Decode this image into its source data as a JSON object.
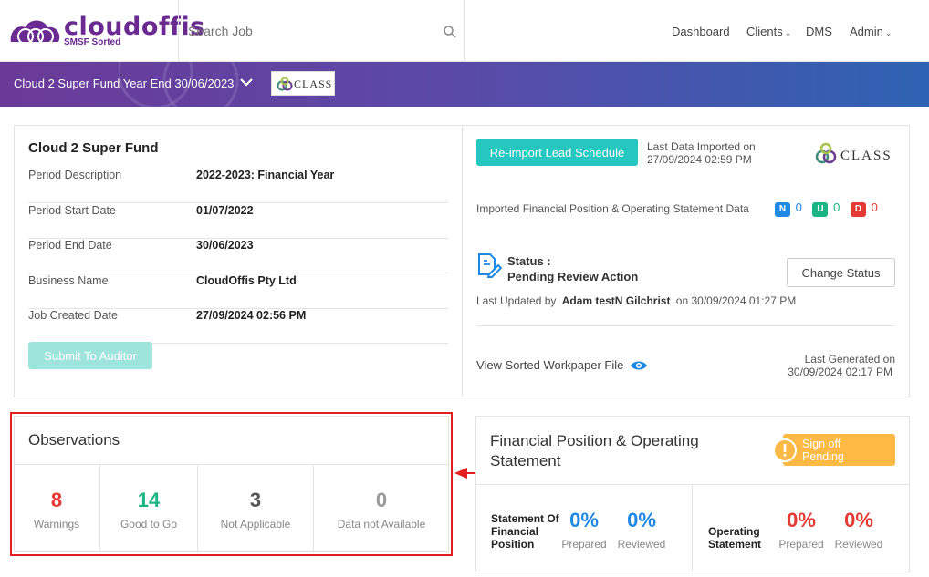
{
  "header": {
    "logo_name": "cloudoffis",
    "logo_sub": "SMSF Sorted",
    "search_placeholder": "Search Job",
    "nav": [
      {
        "label": "Dashboard"
      },
      {
        "label": "Clients"
      },
      {
        "label": "DMS"
      },
      {
        "label": "Admin"
      }
    ]
  },
  "banner": {
    "title": "Cloud 2 Super Fund Year End 30/06/2023",
    "logo_text": "CLASS"
  },
  "fund": {
    "name": "Cloud 2 Super Fund",
    "rows": [
      {
        "label": "Period Description",
        "value": "2022-2023: Financial Year"
      },
      {
        "label": "Period Start Date",
        "value": "01/07/2022"
      },
      {
        "label": "Period End Date",
        "value": "30/06/2023"
      },
      {
        "label": "Business Name",
        "value": "CloudOffis Pty Ltd"
      },
      {
        "label": "Job Created Date",
        "value": "27/09/2024 02:56 PM"
      }
    ],
    "submit_label": "Submit To Auditor"
  },
  "import": {
    "reimport_label": "Re-import Lead Schedule",
    "last_imported_label": "Last Data Imported on",
    "last_imported_value": "27/09/2024 02:59 PM",
    "logo_text": "CLASS",
    "imported_text": "Imported Financial Position & Operating Statement Data",
    "badges": [
      {
        "letter": "N",
        "count": "0",
        "color": "#1e88e5"
      },
      {
        "letter": "U",
        "count": "0",
        "color": "#1bb583"
      },
      {
        "letter": "D",
        "count": "0",
        "color": "#e53935"
      }
    ],
    "status_label": "Status :",
    "status_value": "Pending Review Action",
    "change_status_label": "Change Status",
    "last_updated_prefix": "Last Updated by",
    "last_updated_user": "Adam testN Gilchrist",
    "last_updated_suffix": "on 30/09/2024 01:27 PM",
    "view_workpaper_label": "View Sorted Workpaper File",
    "last_generated_label": "Last Generated on",
    "last_generated_value": "30/09/2024 02:17 PM"
  },
  "observations": {
    "title": "Observations",
    "stats": [
      {
        "value": "8",
        "label": "Warnings",
        "color": "#e53935"
      },
      {
        "value": "14",
        "label": "Good to Go",
        "color": "#1bb583"
      },
      {
        "value": "3",
        "label": "Not Applicable",
        "color": "#555555"
      },
      {
        "value": "0",
        "label": "Data not Available",
        "color": "#999999"
      }
    ]
  },
  "financial": {
    "title": "Financial Position & Operating Statement",
    "signoff_label": "Sign off Pending",
    "statements": [
      {
        "name": "Statement Of Financial Position",
        "prepared": "0%",
        "reviewed": "0%",
        "color": "#1e88e5"
      },
      {
        "name": "Operating Statement",
        "prepared": "0%",
        "reviewed": "0%",
        "color": "#e53935"
      }
    ],
    "prepared_label": "Prepared",
    "reviewed_label": "Reviewed"
  }
}
